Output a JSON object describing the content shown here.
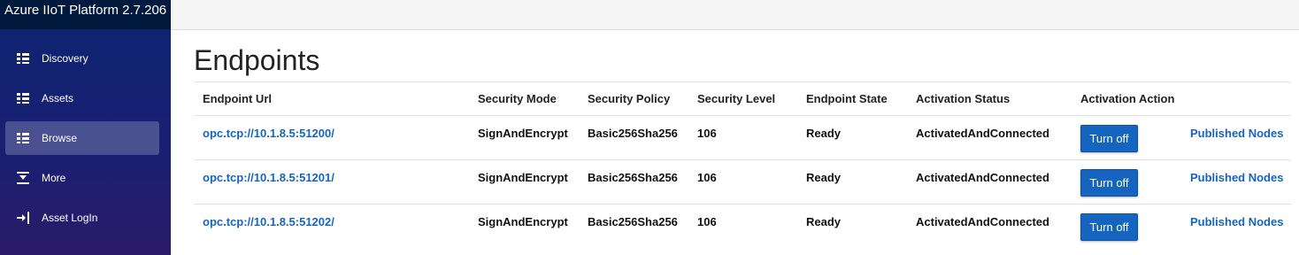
{
  "app": {
    "title": "Azure IIoT Platform 2.7.206"
  },
  "sidebar": {
    "items": [
      {
        "label": "Discovery",
        "icon": "list-icon",
        "active": false
      },
      {
        "label": "Assets",
        "icon": "list-icon",
        "active": false
      },
      {
        "label": "Browse",
        "icon": "list-icon",
        "active": true
      },
      {
        "label": "More",
        "icon": "expand-more-icon",
        "active": false
      },
      {
        "label": "Asset LogIn",
        "icon": "login-icon",
        "active": false
      }
    ]
  },
  "main": {
    "title": "Endpoints",
    "table": {
      "headers": [
        "Endpoint Url",
        "Security Mode",
        "Security Policy",
        "Security Level",
        "Endpoint State",
        "Activation Status",
        "Activation Action",
        ""
      ],
      "rows": [
        {
          "url": "opc.tcp://10.1.8.5:51200/",
          "mode": "SignAndEncrypt",
          "policy": "Basic256Sha256",
          "level": "106",
          "state": "Ready",
          "status": "ActivatedAndConnected",
          "action": "Turn off",
          "link": "Published Nodes"
        },
        {
          "url": "opc.tcp://10.1.8.5:51201/",
          "mode": "SignAndEncrypt",
          "policy": "Basic256Sha256",
          "level": "106",
          "state": "Ready",
          "status": "ActivatedAndConnected",
          "action": "Turn off",
          "link": "Published Nodes"
        },
        {
          "url": "opc.tcp://10.1.8.5:51202/",
          "mode": "SignAndEncrypt",
          "policy": "Basic256Sha256",
          "level": "106",
          "state": "Ready",
          "status": "ActivatedAndConnected",
          "action": "Turn off",
          "link": "Published Nodes"
        }
      ]
    }
  },
  "colors": {
    "sidebar_top": "#0b2470",
    "sidebar_bottom": "#2a1b68",
    "brand_bg": "#031a3f",
    "link": "#1565c0",
    "button": "#1565c0"
  }
}
